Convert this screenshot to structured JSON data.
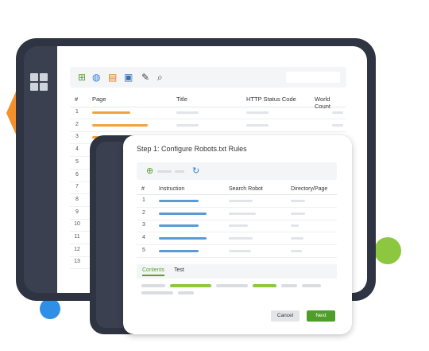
{
  "colors": {
    "orange": "#f2912c",
    "green": "#8dc63f",
    "blue_bar": "#5b9bd5",
    "placeholder": "#d9dde2",
    "dark": "#2e3441"
  },
  "background_window": {
    "toolbar_icons": [
      "add-icon",
      "globe-icon",
      "page-settings-icon",
      "robot-settings-icon",
      "wrench-icon",
      "search-icon"
    ],
    "table": {
      "headers": [
        "#",
        "Page",
        "Title",
        "HTTP Status Code",
        "World Count"
      ],
      "row_numbers": [
        "1",
        "2",
        "3",
        "4",
        "5",
        "6",
        "7",
        "8",
        "9",
        "10",
        "11",
        "12",
        "13"
      ]
    }
  },
  "dialog": {
    "title": "Step 1: Configure Robots.txt Rules",
    "table": {
      "headers": [
        "#",
        "Instruction",
        "Search Robot",
        "Directory/Page"
      ],
      "row_numbers": [
        "1",
        "2",
        "3",
        "4",
        "5"
      ]
    },
    "tabs": [
      "Contents",
      "Test"
    ],
    "cancel_label": "Cancel",
    "next_label": "Next"
  }
}
